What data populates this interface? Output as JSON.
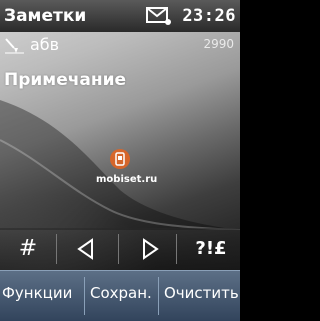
{
  "status_bar": {
    "title": "Заметки",
    "time": "23:26",
    "message_icon": "envelope-icon"
  },
  "editor": {
    "input_mode": "абв",
    "input_icon": "pen-icon",
    "char_counter": "2990",
    "text": "Примечание"
  },
  "watermark": {
    "text": "mobiset.ru",
    "logo_icon": "phone-logo-icon"
  },
  "toolbar": {
    "hash_label": "#",
    "left_icon": "triangle-left-icon",
    "right_icon": "triangle-right-icon",
    "symbols_label": "?!£"
  },
  "softkeys": {
    "left": "Функции",
    "middle": "Сохран.",
    "right": "Очистить"
  },
  "colors": {
    "softkey_bar": "#44566e",
    "watermark_accent": "#e8641e"
  }
}
